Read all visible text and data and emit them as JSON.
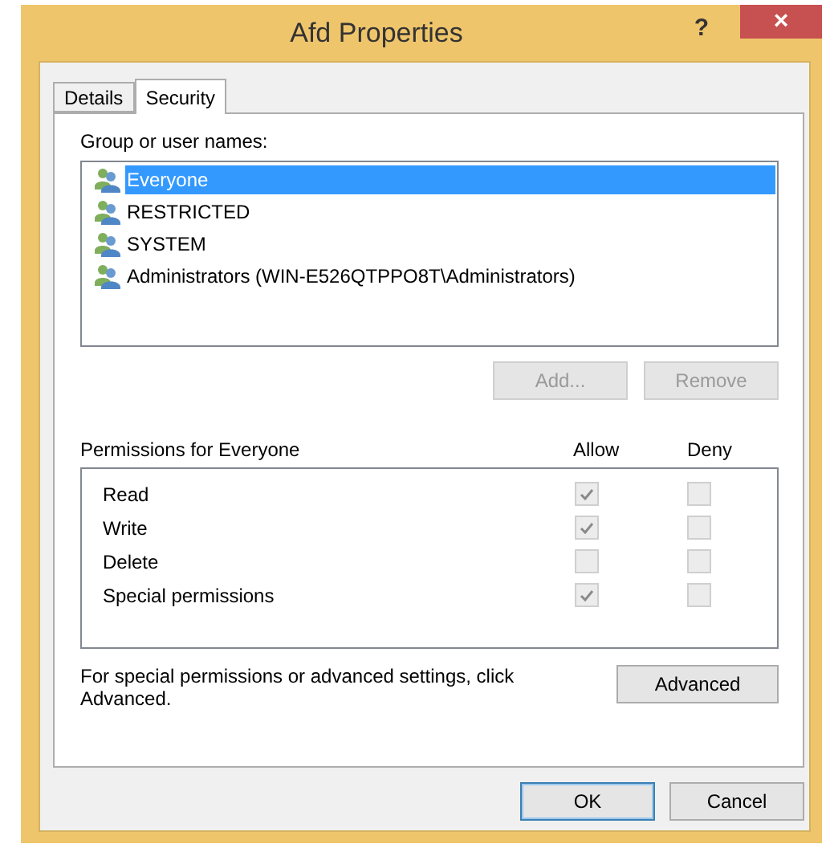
{
  "window": {
    "title": "Afd Properties",
    "help": "?",
    "close": "×"
  },
  "tabs": [
    {
      "label": "Details",
      "selected": false
    },
    {
      "label": "Security",
      "selected": true
    }
  ],
  "group_label": "Group or user names:",
  "users": [
    {
      "name": "Everyone",
      "selected": true
    },
    {
      "name": "RESTRICTED",
      "selected": false
    },
    {
      "name": "SYSTEM",
      "selected": false
    },
    {
      "name": "Administrators (WIN-E526QTPPO8T\\Administrators)",
      "selected": false
    }
  ],
  "user_buttons": [
    {
      "label": "Add...",
      "disabled": true
    },
    {
      "label": "Remove",
      "disabled": true
    }
  ],
  "permissions_label": "Permissions for Everyone",
  "allow_header": "Allow",
  "deny_header": "Deny",
  "permissions": [
    {
      "name": "Read",
      "allow": true,
      "deny": false
    },
    {
      "name": "Write",
      "allow": true,
      "deny": false
    },
    {
      "name": "Delete",
      "allow": false,
      "deny": false
    },
    {
      "name": "Special permissions",
      "allow": true,
      "deny": false
    }
  ],
  "advanced_note": "For special permissions or advanced settings, click Advanced.",
  "advanced_button": "Advanced",
  "buttons": [
    {
      "label": "OK",
      "default": true
    },
    {
      "label": "Cancel",
      "default": false
    }
  ]
}
